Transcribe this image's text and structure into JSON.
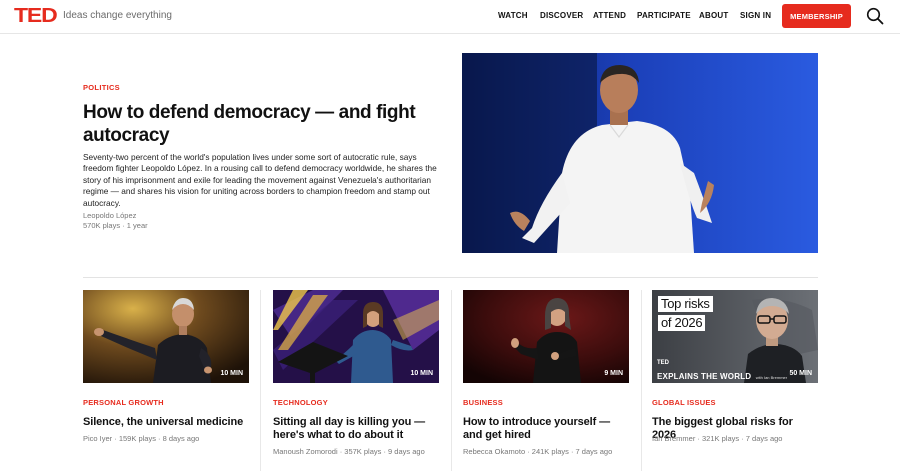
{
  "header": {
    "logo": "TED",
    "tagline": "Ideas change everything",
    "nav": [
      "WATCH",
      "DISCOVER",
      "ATTEND",
      "PARTICIPATE",
      "ABOUT",
      "SIGN IN"
    ],
    "membership_label": "MEMBERSHIP"
  },
  "hero": {
    "category": "POLITICS",
    "title": "How to defend democracy — and fight autocracy",
    "description": "Seventy-two percent of the world's population lives under some sort of autocratic rule, says freedom fighter Leopoldo López. In a rousing call to defend democracy worldwide, he shares the story of his imprisonment and exile for leading the movement against Venezuela's authoritarian regime — and shares his vision for uniting across borders to champion freedom and stamp out autocracy.",
    "speaker": "Leopoldo López",
    "meta": "570K plays · 1 year"
  },
  "cards": [
    {
      "duration": "10 MIN",
      "category": "PERSONAL GROWTH",
      "title": "Silence, the universal medicine",
      "meta": "Pico Iyer · 159K plays · 8 days ago"
    },
    {
      "duration": "10 MIN",
      "category": "TECHNOLOGY",
      "title": "Sitting all day is killing you — here's what to do about it",
      "meta": "Manoush Zomorodi · 357K plays · 9 days ago"
    },
    {
      "duration": "9 MIN",
      "category": "BUSINESS",
      "title": "How to introduce yourself — and get hired",
      "meta": "Rebecca Okamoto · 241K plays · 7 days ago"
    },
    {
      "duration": "50 MIN",
      "category": "GLOBAL ISSUES",
      "title": "The biggest global risks for 2026",
      "meta": "Ian Bremmer · 321K plays · 7 days ago",
      "thumb_text_line1": "Top risks",
      "thumb_text_line2": "of 2026",
      "series_logo": "TED",
      "series_name": "EXPLAINS THE WORLD",
      "series_host": "with Ian Bremmer"
    }
  ],
  "colors": {
    "accent": "#e62b1e",
    "text": "#111111",
    "muted": "#777777"
  }
}
